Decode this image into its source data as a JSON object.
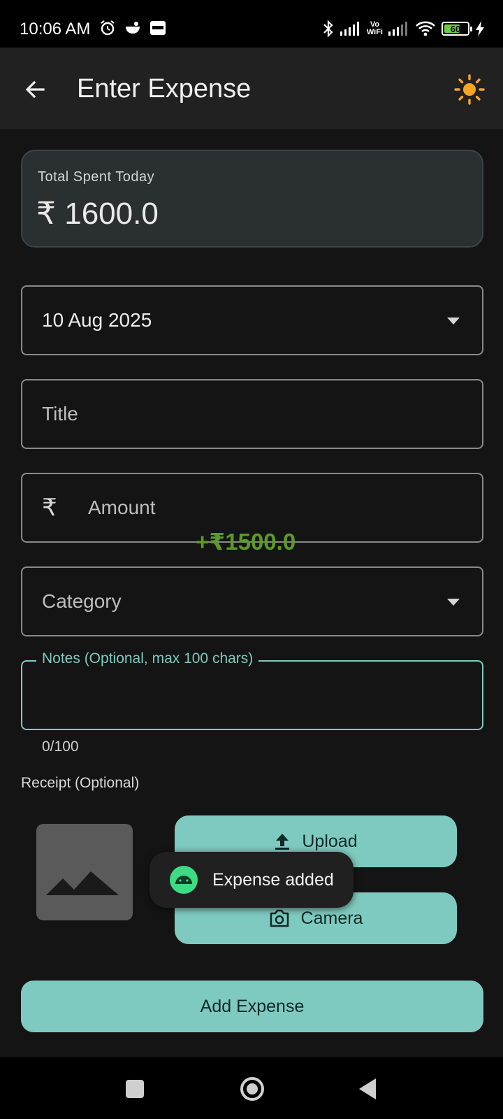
{
  "status_bar": {
    "time": "10:06 AM",
    "vowifi_top": "Vo",
    "vowifi_bottom": "WiFi",
    "battery": "60",
    "icons": [
      "alarm-icon",
      "notification-icon",
      "app-icon",
      "bluetooth-icon",
      "signal-icon",
      "vowifi-icon",
      "signal-icon",
      "wifi-icon",
      "battery-icon",
      "charging-icon"
    ]
  },
  "app_bar": {
    "title": "Enter Expense",
    "back_icon": "arrow-left-icon",
    "theme_icon": "sun-icon"
  },
  "summary": {
    "label": "Total Spent Today",
    "value": "₹ 1600.0"
  },
  "form": {
    "date_value": "10 Aug 2025",
    "title_placeholder": "Title",
    "amount_prefix": "₹",
    "amount_placeholder": "Amount",
    "category_placeholder": "Category",
    "notes_label": "Notes (Optional, max 100 chars)",
    "notes_counter": "0/100"
  },
  "floating_amount": "+₹1500.0",
  "receipt": {
    "label": "Receipt (Optional)",
    "upload_label": "Upload",
    "camera_label": "Camera"
  },
  "toast": {
    "text": "Expense added"
  },
  "primary_action": {
    "label": "Add Expense"
  },
  "colors": {
    "accent": "#7fcac0",
    "background": "#141414",
    "app_bar": "#212121",
    "sun": "#f5a623",
    "positive": "#5b9a28"
  }
}
